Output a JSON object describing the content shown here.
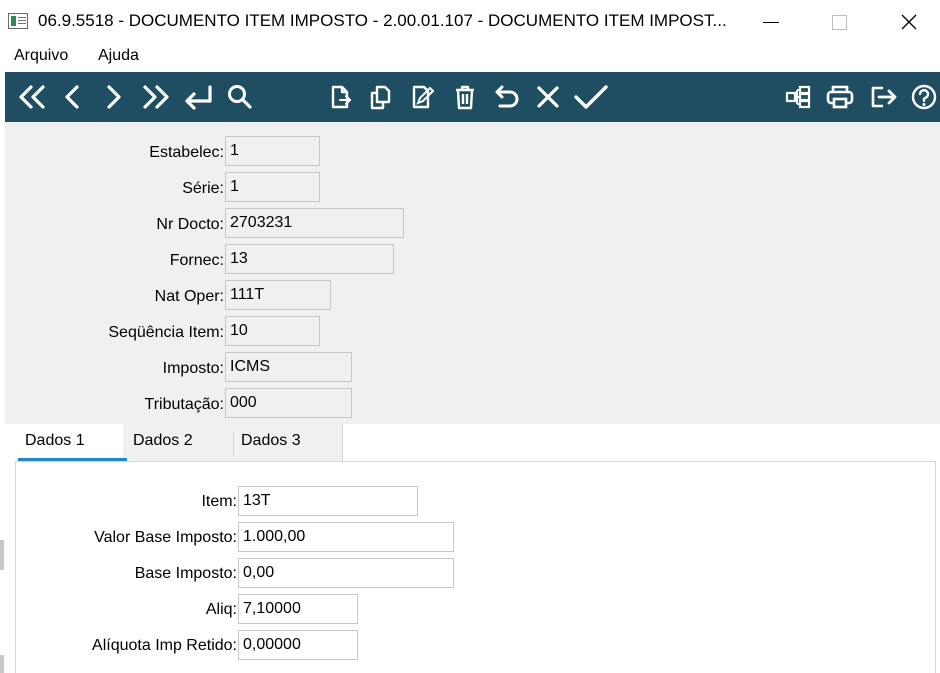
{
  "window": {
    "title": "06.9.5518 - DOCUMENTO ITEM IMPOSTO - 2.00.01.107 - DOCUMENTO ITEM IMPOST...",
    "minimize_glyph": "",
    "close_glyph": "✕"
  },
  "menu": {
    "items": [
      "Arquivo",
      "Ajuda"
    ]
  },
  "toolbar": {
    "color": "#1f4e63",
    "nav_icons": [
      "first-icon",
      "previous-icon",
      "next-icon",
      "last-icon",
      "goto-icon",
      "search-icon"
    ],
    "edit_icons": [
      "new-icon",
      "copy-icon",
      "edit-icon",
      "delete-icon",
      "undo-icon",
      "cancel-icon",
      "save-icon"
    ],
    "right_icons": [
      "tree-icon",
      "print-icon",
      "exit-icon",
      "help-icon"
    ]
  },
  "header_fields": [
    {
      "label": "Estabelec:",
      "value": "1"
    },
    {
      "label": "Série:",
      "value": "1"
    },
    {
      "label": "Nr Docto:",
      "value": "2703231"
    },
    {
      "label": "Fornec:",
      "value": "13"
    },
    {
      "label": "Nat Oper:",
      "value": "111T"
    },
    {
      "label": "Seqüência Item:",
      "value": "10"
    },
    {
      "label": "Imposto:",
      "value": "ICMS"
    },
    {
      "label": "Tributação:",
      "value": "000"
    }
  ],
  "tabs": [
    {
      "label": "Dados 1",
      "active": true
    },
    {
      "label": "Dados 2",
      "active": false
    },
    {
      "label": "Dados 3",
      "active": false
    }
  ],
  "tab_accent": "#1e88c8",
  "dados1_fields": [
    {
      "label": "Item:",
      "value": "13T"
    },
    {
      "label": "Valor Base Imposto:",
      "value": "1.000,00"
    },
    {
      "label": "Base Imposto:",
      "value": "0,00"
    },
    {
      "label": "Aliq:",
      "value": "7,10000"
    },
    {
      "label": "Alíquota Imp Retido:",
      "value": "0,00000"
    }
  ]
}
